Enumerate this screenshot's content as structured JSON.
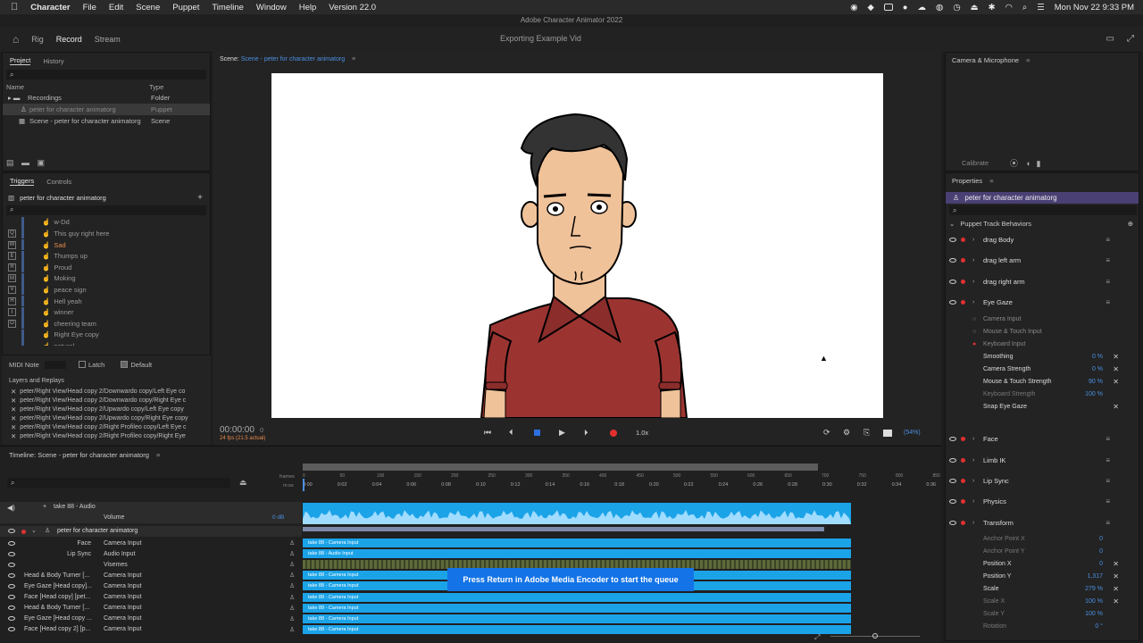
{
  "menubar": {
    "app": "Character",
    "items": [
      "File",
      "Edit",
      "Scene",
      "Puppet",
      "Timeline",
      "Window",
      "Help",
      "Version 22.0"
    ],
    "datetime": "Mon Nov 22  9:33 PM"
  },
  "window_title": "Adobe Character Animator 2022",
  "workspaces": [
    "Rig",
    "Record",
    "Stream"
  ],
  "document_name": "Exporting Example Vid",
  "project_panel": {
    "tabs": [
      "Project",
      "History"
    ],
    "col_name": "Name",
    "col_type": "Type",
    "rows": [
      {
        "name": "Recordings",
        "type": "Folder"
      },
      {
        "name": "peter for character animatorg",
        "type": "Puppet"
      },
      {
        "name": "Scene - peter for character animatorg",
        "type": "Scene"
      }
    ]
  },
  "triggers_panel": {
    "tabs": [
      "Triggers",
      "Controls"
    ],
    "puppet": "peter for character animatorg",
    "items": [
      {
        "key": "",
        "label": "w-Dd"
      },
      {
        "key": "Q",
        "label": "This guy right here"
      },
      {
        "key": "W",
        "label": "Sad"
      },
      {
        "key": "E",
        "label": "Thumps up"
      },
      {
        "key": "R",
        "label": "Proud"
      },
      {
        "key": "M",
        "label": "Moking"
      },
      {
        "key": "V",
        "label": "peace sign"
      },
      {
        "key": "H",
        "label": "Hell yeah"
      },
      {
        "key": "I",
        "label": "winner"
      },
      {
        "key": "O",
        "label": "cheering team"
      },
      {
        "key": "",
        "label": "Right Eye copy"
      },
      {
        "key": "",
        "label": "natural"
      }
    ],
    "midi_note": "MIDI Note",
    "latch": "Latch",
    "default": "Default"
  },
  "layers_replays": {
    "title": "Layers and Replays",
    "items": [
      "peter/Right View/Head copy 2/Downwardo copy/Left Eye co",
      "peter/Right View/Head copy 2/Downwardo copy/Right Eye c",
      "peter/Right View/Head copy 2/Upwardo copy/Left Eye copy",
      "peter/Right View/Head copy 2/Upwardo copy/Right Eye copy",
      "peter/Right View/Head copy 2/Right Profileo copy/Left Eye c",
      "peter/Right View/Head copy 2/Right Profileo copy/Right Eye"
    ]
  },
  "scene_panel": {
    "label": "Scene:",
    "name": "Scene - peter for character animatorg",
    "timecode": "00:00:00",
    "frame": "0",
    "fps": "24 fps (21.5 actual)",
    "speed": "1.0x",
    "zoom": "(54%)"
  },
  "camera_panel": {
    "title": "Camera & Microphone",
    "calibrate": "Calibrate"
  },
  "properties": {
    "title": "Properties",
    "puppet": "peter for character animatorg",
    "section": "Puppet Track Behaviors",
    "behaviors": [
      "drag Body",
      "drag left arm",
      "drag right arm",
      "Eye Gaze"
    ],
    "eye_gaze_inputs": [
      "Camera Input",
      "Mouse & Touch Input",
      "Keyboard Input"
    ],
    "eye_gaze_params": [
      {
        "name": "Smoothing",
        "value": "0 %"
      },
      {
        "name": "Camera Strength",
        "value": "0 %"
      },
      {
        "name": "Mouse & Touch Strength",
        "value": "90 %"
      },
      {
        "name": "Keyboard Strength",
        "value": "100 %"
      },
      {
        "name": "Snap Eye Gaze",
        "value": ""
      }
    ],
    "more_behaviors": [
      "Face",
      "Limb IK",
      "Lip Sync",
      "Physics",
      "Transform"
    ],
    "transform_params": [
      {
        "name": "Anchor Point X",
        "value": "0"
      },
      {
        "name": "Anchor Point Y",
        "value": "0"
      },
      {
        "name": "Position X",
        "value": "0"
      },
      {
        "name": "Position Y",
        "value": "1,317"
      },
      {
        "name": "Scale",
        "value": "279 %"
      },
      {
        "name": "Scale X",
        "value": "100 %"
      },
      {
        "name": "Scale Y",
        "value": "100 %"
      },
      {
        "name": "Rotation",
        "value": "0 °"
      }
    ]
  },
  "timeline": {
    "title": "Timeline: Scene - peter for character animatorg",
    "ruler_frames": "frames",
    "ruler_ms": "m:ss",
    "time_ticks": [
      "0:00",
      "0:02",
      "0:04",
      "0:06",
      "0:08",
      "0:10",
      "0:12",
      "0:14",
      "0:16",
      "0:18",
      "0:20",
      "0:22",
      "0:24",
      "0:26",
      "0:28",
      "0:30",
      "0:32",
      "0:34",
      "0:36"
    ],
    "frame_ticks": [
      "0",
      "50",
      "100",
      "150",
      "200",
      "250",
      "300",
      "350",
      "400",
      "450",
      "500",
      "550",
      "600",
      "650",
      "700",
      "750",
      "800",
      "850"
    ],
    "audio_track": "take 88 - Audio",
    "volume": "Volume",
    "volume_val": "0 dB",
    "puppet_track": "peter for character animatorg",
    "rows": [
      {
        "name": "Face",
        "input": "Camera Input",
        "clip": "take 88 - Camera Input"
      },
      {
        "name": "Lip Sync",
        "input": "Audio Input",
        "clip": "take 88 - Audio Input"
      },
      {
        "name": "",
        "input": "Visemes",
        "clip": ""
      },
      {
        "name": "Head & Body Turner [...",
        "input": "Camera Input",
        "clip": "take 88 - Camera Input"
      },
      {
        "name": "Eye Gaze [Head copy]...",
        "input": "Camera Input",
        "clip": "take 88 - Camera Input"
      },
      {
        "name": "Face [Head copy] [pet...",
        "input": "Camera Input",
        "clip": "take 88 - Camera Input"
      },
      {
        "name": "Head & Body Turner [...",
        "input": "Camera Input",
        "clip": "take 88 - Camera Input"
      },
      {
        "name": "Eye Gaze [Head copy ...",
        "input": "Camera Input",
        "clip": "take 88 - Camera Input"
      },
      {
        "name": "Face [Head copy 2] [p...",
        "input": "Camera Input",
        "clip": "take 88 - Camera Input"
      }
    ],
    "toast": "Press Return in Adobe Media Encoder to start the queue"
  }
}
